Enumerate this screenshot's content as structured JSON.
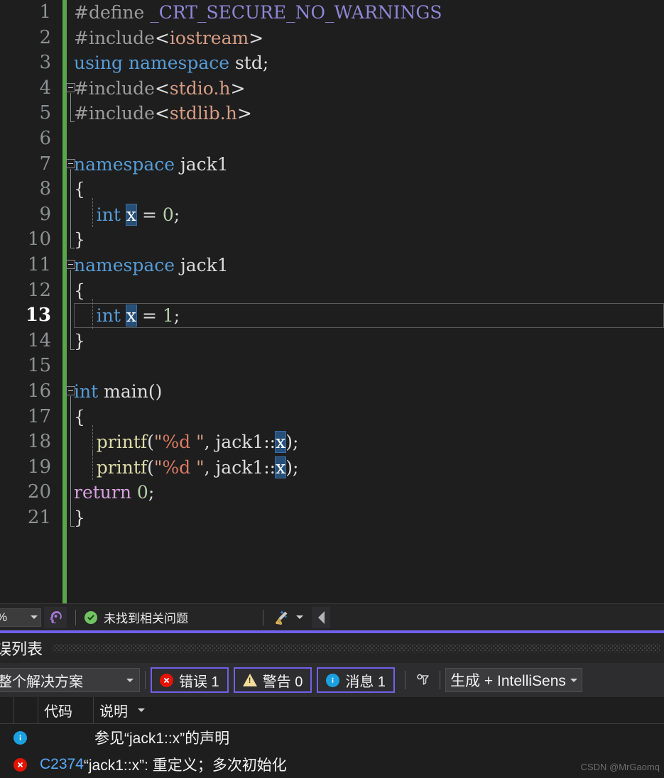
{
  "editor": {
    "language": "cpp",
    "current_line": 13,
    "highlighted_token": "x",
    "lines": [
      {
        "num": "1",
        "indent_guides": 0,
        "fold": null,
        "tokens": [
          {
            "t": "#define ",
            "c": "t-pp"
          },
          {
            "t": "_CRT_SECURE_NO_WARNINGS",
            "c": "t-macro"
          }
        ]
      },
      {
        "num": "2",
        "indent_guides": 0,
        "fold": null,
        "tokens": [
          {
            "t": "#include",
            "c": "t-pp"
          },
          {
            "t": "<",
            "c": "t-plain"
          },
          {
            "t": "iostream",
            "c": "t-str"
          },
          {
            "t": ">",
            "c": "t-plain"
          }
        ]
      },
      {
        "num": "3",
        "indent_guides": 0,
        "fold": null,
        "tokens": [
          {
            "t": "using",
            "c": "t-kw"
          },
          {
            "t": " ",
            "c": "t-plain"
          },
          {
            "t": "namespace",
            "c": "t-kw"
          },
          {
            "t": " std;",
            "c": "t-plain"
          }
        ]
      },
      {
        "num": "4",
        "indent_guides": 0,
        "fold": "start",
        "tokens": [
          {
            "t": "#include",
            "c": "t-pp"
          },
          {
            "t": "<",
            "c": "t-plain"
          },
          {
            "t": "stdio.h",
            "c": "t-str"
          },
          {
            "t": ">",
            "c": "t-plain"
          }
        ]
      },
      {
        "num": "5",
        "indent_guides": 0,
        "fold": "end",
        "tokens": [
          {
            "t": "#include",
            "c": "t-pp"
          },
          {
            "t": "<",
            "c": "t-plain"
          },
          {
            "t": "stdlib.h",
            "c": "t-str"
          },
          {
            "t": ">",
            "c": "t-plain"
          }
        ]
      },
      {
        "num": "6",
        "indent_guides": 0,
        "fold": null,
        "tokens": []
      },
      {
        "num": "7",
        "indent_guides": 0,
        "fold": "start",
        "tokens": [
          {
            "t": "namespace",
            "c": "t-kw"
          },
          {
            "t": " jack1",
            "c": "t-plain"
          }
        ]
      },
      {
        "num": "8",
        "indent_guides": 0,
        "fold": null,
        "tokens": [
          {
            "t": "{",
            "c": "t-punct"
          }
        ]
      },
      {
        "num": "9",
        "indent_guides": 1,
        "fold": null,
        "tokens": [
          {
            "t": "    ",
            "c": "t-plain"
          },
          {
            "t": "int",
            "c": "t-kw"
          },
          {
            "t": " ",
            "c": "t-plain"
          },
          {
            "t": "x",
            "c": "t-hl"
          },
          {
            "t": " = ",
            "c": "t-plain"
          },
          {
            "t": "0",
            "c": "t-num"
          },
          {
            "t": ";",
            "c": "t-plain"
          }
        ]
      },
      {
        "num": "10",
        "indent_guides": 0,
        "fold": "end",
        "tokens": [
          {
            "t": "}",
            "c": "t-punct"
          }
        ]
      },
      {
        "num": "11",
        "indent_guides": 0,
        "fold": "start",
        "tokens": [
          {
            "t": "namespace",
            "c": "t-kw"
          },
          {
            "t": " jack1",
            "c": "t-plain"
          }
        ]
      },
      {
        "num": "12",
        "indent_guides": 0,
        "fold": null,
        "tokens": [
          {
            "t": "{",
            "c": "t-punct"
          }
        ]
      },
      {
        "num": "13",
        "indent_guides": 1,
        "fold": null,
        "tokens": [
          {
            "t": "    ",
            "c": "t-plain"
          },
          {
            "t": "int",
            "c": "t-kw"
          },
          {
            "t": " ",
            "c": "t-plain"
          },
          {
            "t": "x",
            "c": "t-hl"
          },
          {
            "t": " = ",
            "c": "t-plain"
          },
          {
            "t": "1",
            "c": "t-num"
          },
          {
            "t": ";",
            "c": "t-plain"
          }
        ]
      },
      {
        "num": "14",
        "indent_guides": 0,
        "fold": "end",
        "tokens": [
          {
            "t": "}",
            "c": "t-punct"
          }
        ]
      },
      {
        "num": "15",
        "indent_guides": 0,
        "fold": null,
        "tokens": []
      },
      {
        "num": "16",
        "indent_guides": 0,
        "fold": "start",
        "tokens": [
          {
            "t": "int",
            "c": "t-kw"
          },
          {
            "t": " ",
            "c": "t-plain"
          },
          {
            "t": "main",
            "c": "t-plain"
          },
          {
            "t": "()",
            "c": "t-punct"
          }
        ]
      },
      {
        "num": "17",
        "indent_guides": 0,
        "fold": null,
        "tokens": [
          {
            "t": "{",
            "c": "t-punct"
          }
        ]
      },
      {
        "num": "18",
        "indent_guides": 1,
        "fold": null,
        "tokens": [
          {
            "t": "    ",
            "c": "t-plain"
          },
          {
            "t": "printf",
            "c": "t-func"
          },
          {
            "t": "(",
            "c": "t-punct"
          },
          {
            "t": "\"",
            "c": "t-str"
          },
          {
            "t": "%d",
            "c": "t-fmt"
          },
          {
            "t": " \"",
            "c": "t-str"
          },
          {
            "t": ", jack1::",
            "c": "t-plain"
          },
          {
            "t": "x",
            "c": "t-hl"
          },
          {
            "t": ");",
            "c": "t-punct"
          }
        ]
      },
      {
        "num": "19",
        "indent_guides": 1,
        "fold": null,
        "tokens": [
          {
            "t": "    ",
            "c": "t-plain"
          },
          {
            "t": "printf",
            "c": "t-func"
          },
          {
            "t": "(",
            "c": "t-punct"
          },
          {
            "t": "\"",
            "c": "t-str"
          },
          {
            "t": "%d",
            "c": "t-fmt"
          },
          {
            "t": " \"",
            "c": "t-str"
          },
          {
            "t": ", jack1::",
            "c": "t-plain"
          },
          {
            "t": "x",
            "c": "t-hl"
          },
          {
            "t": ");",
            "c": "t-punct"
          }
        ]
      },
      {
        "num": "20",
        "indent_guides": 0,
        "fold": null,
        "tokens": [
          {
            "t": "return",
            "c": "t-ctrl"
          },
          {
            "t": " ",
            "c": "t-plain"
          },
          {
            "t": "0",
            "c": "t-num"
          },
          {
            "t": ";",
            "c": "t-plain"
          }
        ]
      },
      {
        "num": "21",
        "indent_guides": 0,
        "fold": "end",
        "tokens": [
          {
            "t": "}",
            "c": "t-punct"
          }
        ]
      }
    ]
  },
  "status_bar": {
    "zoom_value": "%",
    "intellicode_icon": "brain-head-icon",
    "issue_status": "未找到相关问题",
    "status_ok_icon": "check-circle-icon",
    "cleanup_icon": "broom-icon",
    "collapse_icon": "caret-left-icon"
  },
  "error_panel": {
    "title": "误列表",
    "accent_color": "#7160e8",
    "toolbar": {
      "scope": "整个解决方案",
      "errors": {
        "label": "错误 1",
        "count": 1,
        "icon": "error-circle-icon",
        "color": "#e51400"
      },
      "warnings": {
        "label": "警告 0",
        "count": 0,
        "icon": "warning-triangle-icon",
        "color": "#f2dc9b"
      },
      "messages": {
        "label": "消息 1",
        "count": 1,
        "icon": "info-circle-icon",
        "color": "#1ba1e2"
      },
      "filter_icon": "filter-icon",
      "build_source": "生成 + IntelliSens"
    },
    "columns": [
      "代码",
      "说明"
    ],
    "rows": [
      {
        "severity": "info",
        "icon": "info-circle-icon",
        "code": "",
        "description": "参见“jack1::x”的声明"
      },
      {
        "severity": "error",
        "icon": "error-circle-icon",
        "code": "C2374",
        "description": "“jack1::x”: 重定义；多次初始化"
      }
    ],
    "watermark": "CSDN @MrGaomq"
  }
}
